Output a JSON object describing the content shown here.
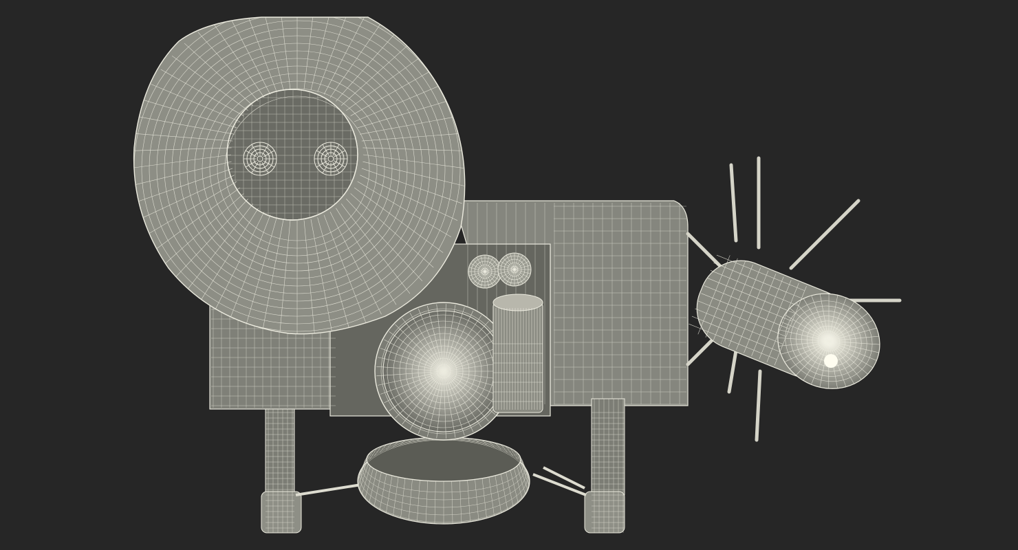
{
  "scene": {
    "subject": "wireframe-render",
    "colors": {
      "background": "#262626",
      "surface": "#8a8a80",
      "surface_dark": "#5e5f58",
      "surface_inner": "#6d6e66",
      "wire": "#f1f0e6",
      "glow": "#fffdf0"
    }
  }
}
